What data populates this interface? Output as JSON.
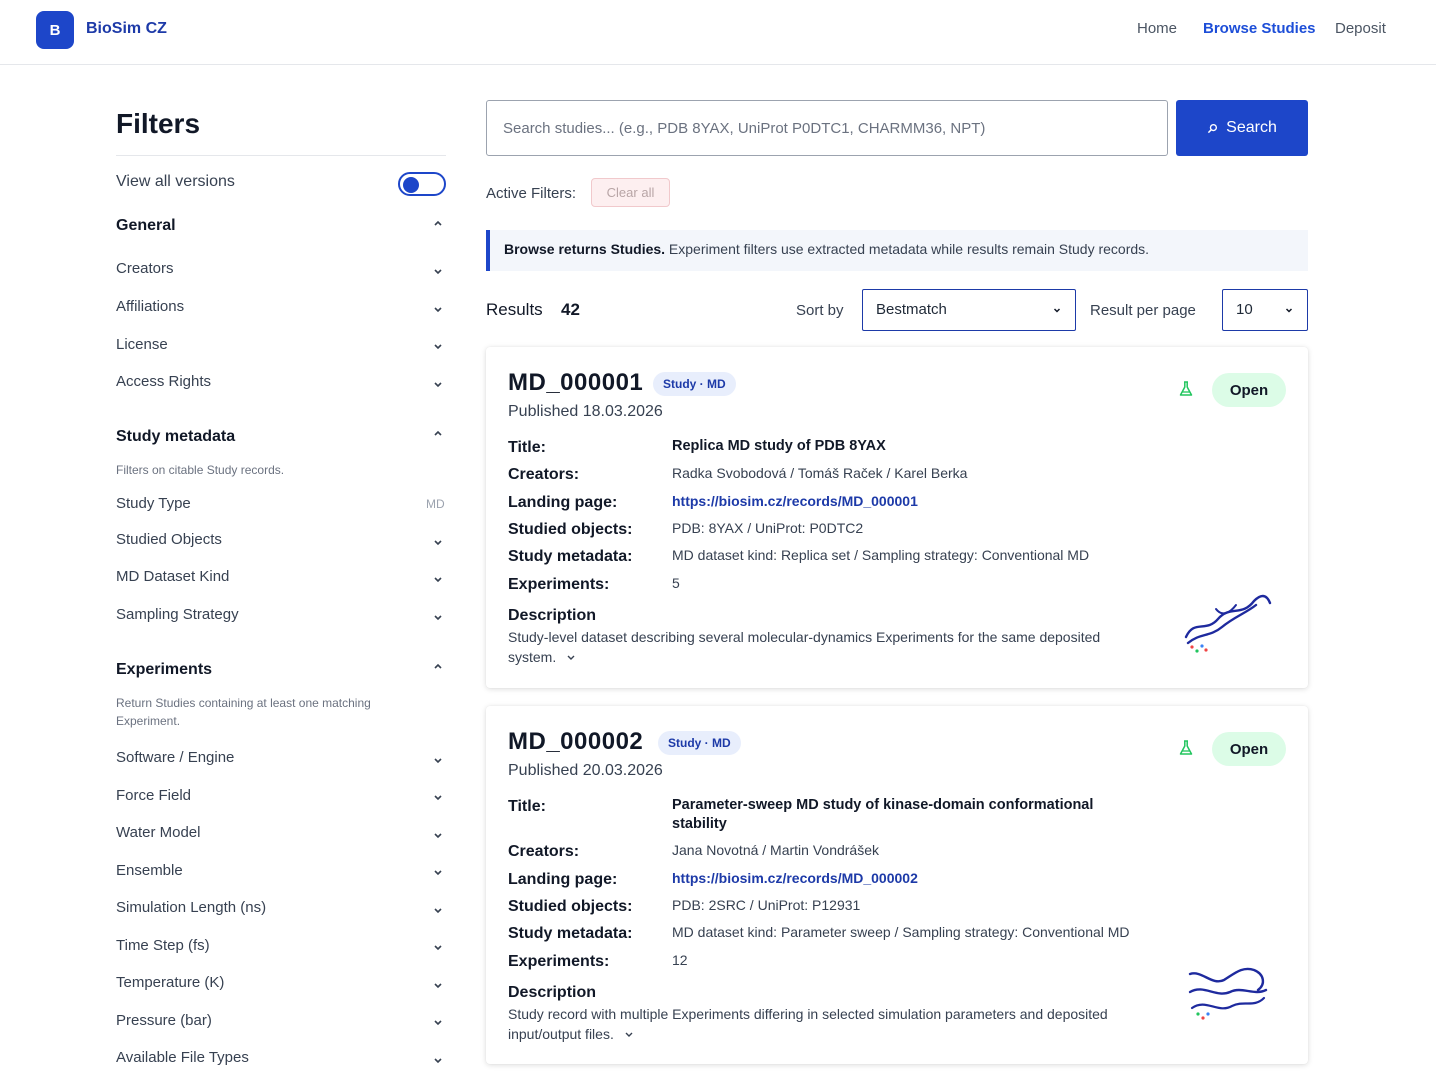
{
  "header": {
    "logo_letter": "B",
    "brand": "BioSim CZ",
    "nav": [
      "Home",
      "Browse Studies",
      "Deposit"
    ]
  },
  "sidebar": {
    "title": "Filters",
    "view_all_versions": "View all versions",
    "general": {
      "title": "General",
      "items": [
        "Creators",
        "Affiliations",
        "License",
        "Access Rights"
      ]
    },
    "study_metadata": {
      "title": "Study metadata",
      "note": "Filters on citable Study records.",
      "items": [
        "Study Type",
        "Studied Objects",
        "MD Dataset Kind",
        "Sampling Strategy"
      ],
      "study_type_tag": "MD"
    },
    "experiments": {
      "title": "Experiments",
      "note": "Return Studies containing at least one matching Experiment.",
      "items": [
        "Software / Engine",
        "Force Field",
        "Water Model",
        "Ensemble",
        "Simulation Length (ns)",
        "Time Step (fs)",
        "Temperature (K)",
        "Pressure (bar)",
        "Available File Types"
      ]
    }
  },
  "search": {
    "placeholder": "Search studies... (e.g., PDB 8YAX, UniProt P0DTC1, CHARMM36, NPT)",
    "button": "Search"
  },
  "active_filters": {
    "label": "Active Filters:",
    "clear": "Clear all"
  },
  "info": {
    "bold": "Browse returns Studies.",
    "text": " Experiment filters use extracted metadata while results remain Study records."
  },
  "results": {
    "label": "Results",
    "count": "42",
    "sort_label": "Sort by",
    "sort_value": "Bestmatch",
    "rpp_label": "Result per page",
    "rpp_value": "10"
  },
  "field_labels": {
    "title": "Title:",
    "creators": "Creators:",
    "landing": "Landing page:",
    "objects": "Studied objects:",
    "metadata": "Study metadata:",
    "experiments": "Experiments:",
    "description": "Description"
  },
  "cards": [
    {
      "id": "MD_000001",
      "badge": "Study · MD",
      "published": "Published 18.03.2026",
      "access": "Open",
      "title": "Replica MD study of PDB 8YAX",
      "creators": "Radka Svobodová / Tomáš Raček / Karel Berka",
      "landing": "https://biosim.cz/records/MD_000001",
      "objects": "PDB: 8YAX / UniProt: P0DTC2",
      "metadata": "MD dataset kind: Replica set / Sampling strategy: Conventional MD",
      "experiments": "5",
      "description": "Study-level dataset describing several molecular-dynamics Experiments for the same deposited system."
    },
    {
      "id": "MD_000002",
      "badge": "Study · MD",
      "published": "Published 20.03.2026",
      "access": "Open",
      "title": "Parameter-sweep MD study of kinase-domain conformational stability",
      "creators": "Jana Novotná / Martin Vondrášek",
      "landing": "https://biosim.cz/records/MD_000002",
      "objects": "PDB: 2SRC / UniProt: P12931",
      "metadata": "MD dataset kind: Parameter sweep / Sampling strategy: Conventional MD",
      "experiments": "12",
      "description": "Study record with multiple Experiments differing in selected simulation parameters and deposited input/output files."
    }
  ],
  "colors": {
    "accent": "#1d46c9",
    "brand_text": "#1d3aa8",
    "open_bg": "#dcfce7",
    "clear_bg": "#fdeff0"
  },
  "icons": [
    "chevron-down-icon",
    "chevron-up-icon",
    "search-icon",
    "flask-icon",
    "molecule-thumbnail"
  ]
}
